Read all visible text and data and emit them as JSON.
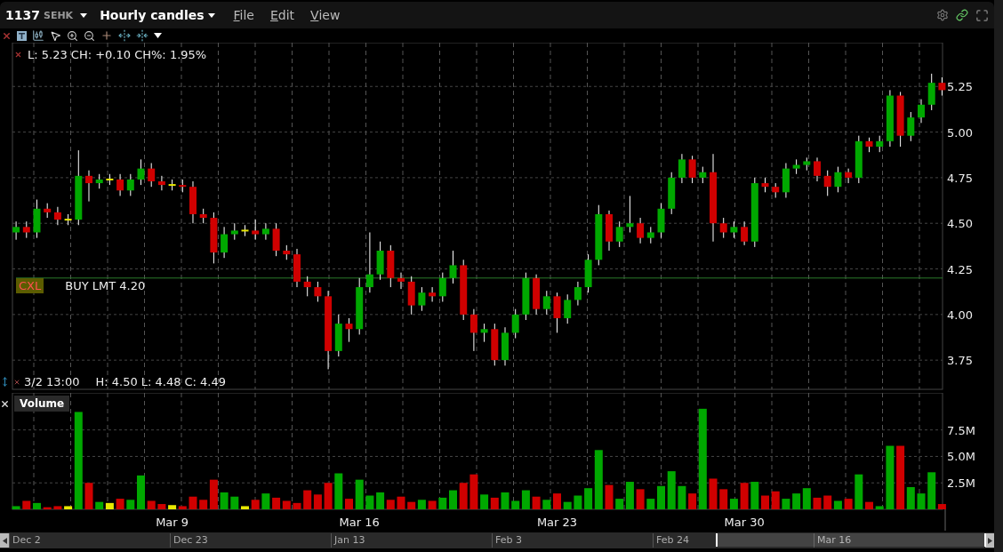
{
  "header": {
    "symbol": "1137",
    "exchange": "SEHK",
    "chart_title": "Hourly candles",
    "menus": [
      "File",
      "Edit",
      "View"
    ]
  },
  "price_panel": {
    "info": "L: 5.23 CH: +0.10 CH%: 1.95%",
    "order": {
      "cancel_label": "CXL",
      "text": "BUY LMT 4.20"
    },
    "cursor_info": {
      "time": "3/2 13:00",
      "high": "H: 4.50",
      "low": "L: 4.48",
      "close": "C: 4.49"
    },
    "chart_data": {
      "type": "candlestick",
      "grid": true,
      "ylim": [
        3.59,
        5.49
      ],
      "yticks": [
        {
          "value": 3.75,
          "label": "3.75"
        },
        {
          "value": 4,
          "label": "4.00"
        },
        {
          "value": 4.25,
          "label": "4.25"
        },
        {
          "value": 4.5,
          "label": "4.50"
        },
        {
          "value": 4.75,
          "label": "4.75"
        },
        {
          "value": 5,
          "label": "5.00"
        },
        {
          "value": 5.25,
          "label": "5.25"
        }
      ],
      "categories": [
        null,
        null,
        null,
        null,
        null,
        null,
        null,
        null,
        null,
        null,
        null,
        null,
        null,
        null,
        null,
        null,
        null,
        null,
        null,
        null,
        null,
        null,
        null,
        null,
        null,
        null,
        null,
        null,
        null,
        null,
        null,
        null,
        null,
        null,
        null,
        null,
        null,
        null,
        null,
        null,
        null,
        null,
        null,
        null,
        null,
        null,
        null,
        null,
        null,
        null,
        null,
        null,
        null,
        null,
        null,
        null,
        null,
        null,
        null,
        null,
        null,
        null,
        null,
        null,
        null,
        null,
        null,
        null,
        null,
        null,
        null,
        null,
        null,
        null,
        null,
        null,
        null,
        null,
        null,
        null,
        null,
        null,
        null,
        null,
        null,
        null,
        null,
        null,
        null,
        null
      ],
      "ohlc": [
        [
          4.45,
          4.51,
          4.41,
          4.48
        ],
        [
          4.48,
          4.51,
          4.42,
          4.45
        ],
        [
          4.45,
          4.63,
          4.42,
          4.58
        ],
        [
          4.58,
          4.61,
          4.53,
          4.56
        ],
        [
          4.56,
          4.59,
          4.49,
          4.52
        ],
        [
          4.52,
          4.55,
          4.49,
          4.52
        ],
        [
          4.52,
          4.9,
          4.49,
          4.76
        ],
        [
          4.76,
          4.79,
          4.62,
          4.72
        ],
        [
          4.72,
          4.77,
          4.69,
          4.74
        ],
        [
          4.74,
          4.77,
          4.71,
          4.74
        ],
        [
          4.74,
          4.77,
          4.65,
          4.68
        ],
        [
          4.68,
          4.77,
          4.65,
          4.74
        ],
        [
          4.74,
          4.85,
          4.71,
          4.8
        ],
        [
          4.8,
          4.83,
          4.7,
          4.73
        ],
        [
          4.73,
          4.76,
          4.68,
          4.71
        ],
        [
          4.71,
          4.74,
          4.68,
          4.71
        ],
        [
          4.71,
          4.74,
          4.67,
          4.7
        ],
        [
          4.7,
          4.73,
          4.5,
          4.55
        ],
        [
          4.55,
          4.58,
          4.5,
          4.53
        ],
        [
          4.53,
          4.56,
          4.28,
          4.34
        ],
        [
          4.34,
          4.48,
          4.31,
          4.44
        ],
        [
          4.44,
          4.5,
          4.41,
          4.46
        ],
        [
          4.46,
          4.49,
          4.43,
          4.46
        ],
        [
          4.46,
          4.52,
          4.41,
          4.44
        ],
        [
          4.44,
          4.5,
          4.41,
          4.47
        ],
        [
          4.47,
          4.5,
          4.32,
          4.35
        ],
        [
          4.35,
          4.38,
          4.3,
          4.33
        ],
        [
          4.33,
          4.36,
          4.15,
          4.18
        ],
        [
          4.18,
          4.21,
          4.1,
          4.15
        ],
        [
          4.15,
          4.18,
          4.07,
          4.1
        ],
        [
          4.1,
          4.13,
          3.7,
          3.8
        ],
        [
          3.8,
          4.0,
          3.77,
          3.95
        ],
        [
          3.95,
          3.98,
          3.85,
          3.92
        ],
        [
          3.92,
          4.2,
          3.89,
          4.15
        ],
        [
          4.15,
          4.45,
          4.12,
          4.22
        ],
        [
          4.22,
          4.4,
          4.19,
          4.35
        ],
        [
          4.35,
          4.38,
          4.15,
          4.2
        ],
        [
          4.2,
          4.23,
          4.14,
          4.18
        ],
        [
          4.18,
          4.21,
          4.0,
          4.05
        ],
        [
          4.05,
          4.15,
          4.02,
          4.12
        ],
        [
          4.12,
          4.15,
          4.07,
          4.1
        ],
        [
          4.1,
          4.23,
          4.07,
          4.2
        ],
        [
          4.2,
          4.35,
          4.17,
          4.27
        ],
        [
          4.27,
          4.3,
          3.97,
          4.0
        ],
        [
          4.0,
          4.03,
          3.8,
          3.9
        ],
        [
          3.9,
          3.95,
          3.85,
          3.92
        ],
        [
          3.92,
          3.95,
          3.72,
          3.75
        ],
        [
          3.75,
          3.93,
          3.72,
          3.9
        ],
        [
          3.9,
          4.03,
          3.87,
          4.0
        ],
        [
          4.0,
          4.23,
          3.97,
          4.2
        ],
        [
          4.2,
          4.22,
          4.0,
          4.03
        ],
        [
          4.03,
          4.13,
          4.0,
          4.1
        ],
        [
          4.1,
          4.12,
          3.9,
          3.98
        ],
        [
          3.98,
          4.11,
          3.95,
          4.08
        ],
        [
          4.08,
          4.18,
          4.05,
          4.15
        ],
        [
          4.15,
          4.33,
          4.12,
          4.3
        ],
        [
          4.3,
          4.6,
          4.27,
          4.55
        ],
        [
          4.55,
          4.57,
          4.35,
          4.4
        ],
        [
          4.4,
          4.51,
          4.37,
          4.48
        ],
        [
          4.48,
          4.65,
          4.45,
          4.5
        ],
        [
          4.5,
          4.53,
          4.39,
          4.42
        ],
        [
          4.42,
          4.48,
          4.39,
          4.45
        ],
        [
          4.45,
          4.61,
          4.42,
          4.58
        ],
        [
          4.58,
          4.78,
          4.55,
          4.75
        ],
        [
          4.75,
          4.88,
          4.72,
          4.85
        ],
        [
          4.85,
          4.87,
          4.72,
          4.75
        ],
        [
          4.75,
          4.81,
          4.72,
          4.78
        ],
        [
          4.78,
          4.88,
          4.4,
          4.5
        ],
        [
          4.5,
          4.53,
          4.42,
          4.45
        ],
        [
          4.45,
          4.51,
          4.42,
          4.48
        ],
        [
          4.48,
          4.51,
          4.38,
          4.4
        ],
        [
          4.4,
          4.75,
          4.37,
          4.72
        ],
        [
          4.72,
          4.75,
          4.67,
          4.7
        ],
        [
          4.7,
          4.72,
          4.64,
          4.67
        ],
        [
          4.67,
          4.83,
          4.64,
          4.8
        ],
        [
          4.8,
          4.85,
          4.77,
          4.82
        ],
        [
          4.82,
          4.86,
          4.79,
          4.84
        ],
        [
          4.84,
          4.86,
          4.73,
          4.76
        ],
        [
          4.76,
          4.79,
          4.65,
          4.7
        ],
        [
          4.7,
          4.81,
          4.67,
          4.78
        ],
        [
          4.78,
          4.8,
          4.72,
          4.75
        ],
        [
          4.75,
          4.98,
          4.72,
          4.95
        ],
        [
          4.95,
          4.97,
          4.89,
          4.92
        ],
        [
          4.92,
          4.98,
          4.89,
          4.95
        ],
        [
          4.95,
          5.23,
          4.92,
          5.2
        ],
        [
          5.2,
          5.22,
          4.92,
          4.98
        ],
        [
          4.98,
          5.11,
          4.95,
          5.08
        ],
        [
          5.08,
          5.18,
          5.05,
          5.15
        ],
        [
          5.15,
          5.32,
          5.12,
          5.27
        ],
        [
          5.27,
          5.3,
          5.2,
          5.23
        ]
      ],
      "ref_lines": [
        {
          "axis": "y",
          "value": 4.2
        }
      ]
    }
  },
  "volume_panel": {
    "chart_data": {
      "type": "bar",
      "title": "Volume",
      "grid": true,
      "ylim": [
        0,
        11
      ],
      "yticks": [
        {
          "value": 2.5,
          "label": "2.5M"
        },
        {
          "value": 5,
          "label": "5.0M"
        },
        {
          "value": 7.5,
          "label": "7.5M"
        }
      ],
      "categories": [
        null,
        null,
        null,
        null,
        null,
        null,
        null,
        null,
        null,
        null,
        null,
        null,
        null,
        null,
        null,
        "Mar 9",
        null,
        null,
        null,
        null,
        null,
        null,
        null,
        null,
        null,
        null,
        null,
        null,
        null,
        null,
        null,
        null,
        null,
        "Mar 16",
        null,
        null,
        null,
        null,
        null,
        null,
        null,
        null,
        null,
        null,
        null,
        null,
        null,
        null,
        null,
        null,
        null,
        null,
        "Mar 23",
        null,
        null,
        null,
        null,
        null,
        null,
        null,
        null,
        null,
        null,
        null,
        null,
        null,
        null,
        null,
        null,
        null,
        "Mar 30",
        null,
        null,
        null,
        null,
        null,
        null,
        null,
        null,
        null,
        null,
        null,
        null,
        null,
        null,
        null,
        null,
        null,
        null,
        null
      ],
      "values": [
        0.3,
        0.8,
        0.6,
        0.2,
        0.3,
        0.3,
        9.2,
        2.5,
        0.7,
        0.6,
        1.0,
        0.9,
        3.2,
        0.8,
        0.5,
        0.4,
        0.3,
        1.2,
        0.9,
        2.8,
        1.6,
        1.2,
        0.3,
        0.9,
        1.5,
        1.1,
        0.8,
        0.6,
        1.8,
        1.4,
        2.5,
        3.4,
        1.0,
        2.8,
        1.3,
        1.6,
        0.9,
        1.2,
        0.7,
        0.9,
        0.8,
        1.1,
        1.8,
        2.5,
        3.3,
        1.4,
        1.1,
        1.6,
        0.8,
        1.8,
        1.2,
        0.9,
        1.5,
        0.7,
        1.3,
        2.0,
        5.6,
        2.3,
        1.0,
        2.6,
        1.9,
        1.0,
        2.2,
        3.6,
        2.2,
        1.5,
        9.5,
        2.9,
        1.9,
        1.0,
        2.5,
        2.6,
        1.3,
        1.7,
        1.0,
        1.5,
        2.0,
        1.1,
        1.3,
        0.8,
        1.0,
        3.3,
        0.7,
        0.3,
        6.0,
        6.0,
        2.1,
        1.5,
        3.5,
        0.5
      ]
    }
  },
  "navigator": {
    "labels": [
      "Dec 2",
      "Dec 23",
      "Jan 13",
      "Feb 3",
      "Feb 24",
      "Mar 16"
    ]
  }
}
